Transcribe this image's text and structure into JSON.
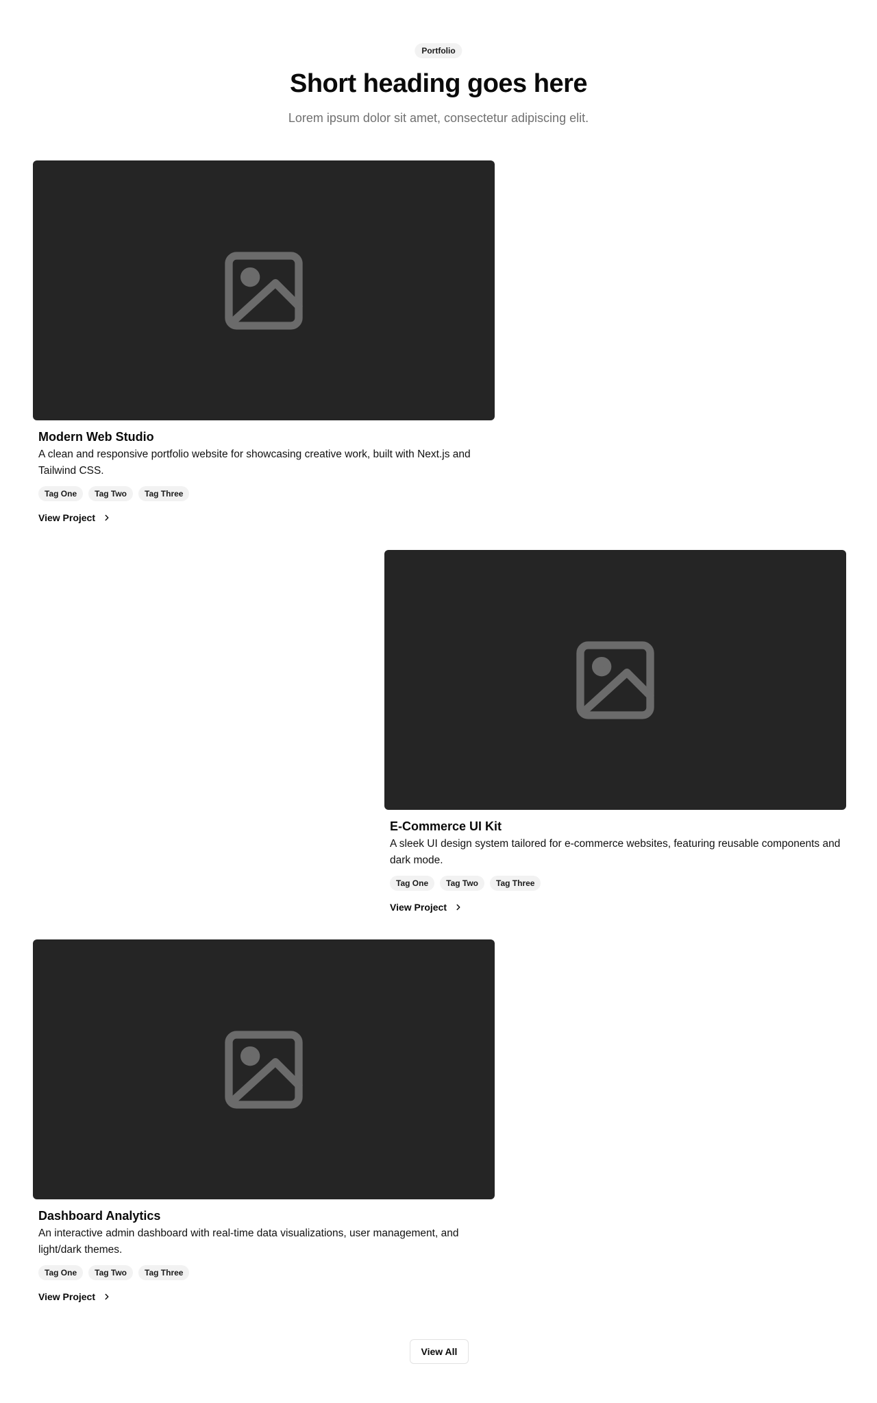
{
  "header": {
    "badge": "Portfolio",
    "title": "Short heading goes here",
    "subtitle": "Lorem ipsum dolor sit amet, consectetur adipiscing elit."
  },
  "projects": [
    {
      "title": "Modern Web Studio",
      "description": "A clean and responsive portfolio website for showcasing creative work, built with Next.js and Tailwind CSS.",
      "tags": [
        "Tag One",
        "Tag Two",
        "Tag Three"
      ],
      "link_label": "View Project",
      "image_icon": "image-placeholder-icon"
    },
    {
      "title": "E-Commerce UI Kit",
      "description": "A sleek UI design system tailored for e-commerce websites, featuring reusable components and dark mode.",
      "tags": [
        "Tag One",
        "Tag Two",
        "Tag Three"
      ],
      "link_label": "View Project",
      "image_icon": "image-placeholder-icon"
    },
    {
      "title": "Dashboard Analytics",
      "description": "An interactive admin dashboard with real-time data visualizations, user management, and light/dark themes.",
      "tags": [
        "Tag One",
        "Tag Two",
        "Tag Three"
      ],
      "link_label": "View Project",
      "image_icon": "image-placeholder-icon"
    }
  ],
  "footer": {
    "view_all_label": "View All"
  },
  "colors": {
    "image_bg": "#252525",
    "icon": "#6b6b6b",
    "badge_bg": "#f2f2f2",
    "muted_text": "#707070"
  }
}
